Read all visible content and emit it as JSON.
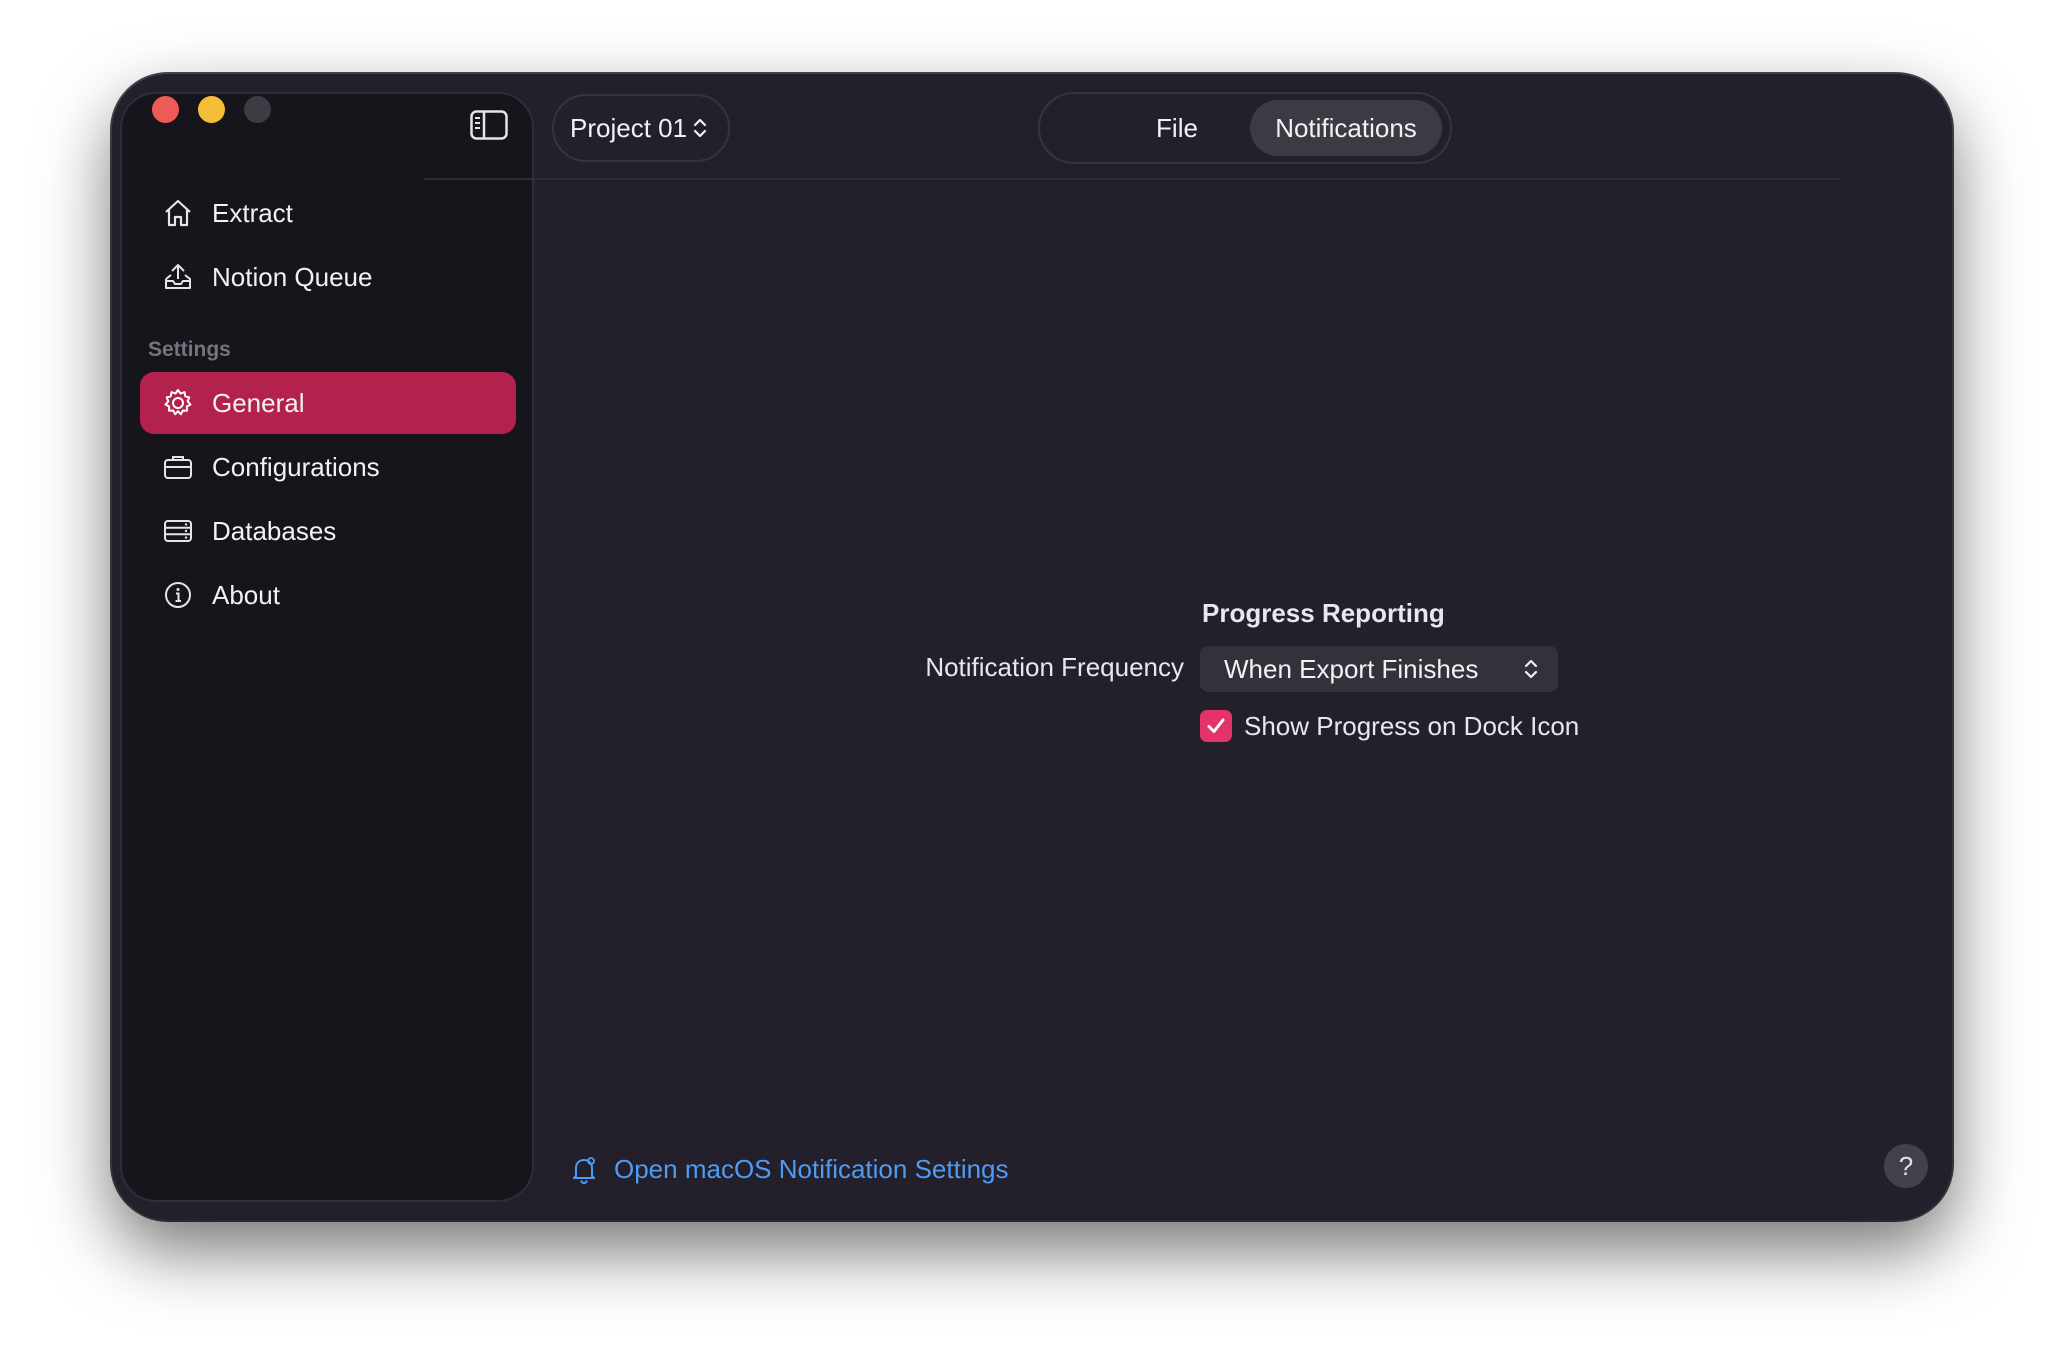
{
  "window": {
    "traffic_lights": [
      "close",
      "minimize",
      "zoom"
    ]
  },
  "sidebar": {
    "toggle_icon": "sidebar-toggle-icon",
    "items": [
      {
        "label": "Extract",
        "icon": "house-icon"
      },
      {
        "label": "Notion Queue",
        "icon": "tray-upload-icon"
      }
    ],
    "section_label": "Settings",
    "settings_items": [
      {
        "label": "General",
        "icon": "gear-icon",
        "selected": true
      },
      {
        "label": "Configurations",
        "icon": "briefcase-icon"
      },
      {
        "label": "Databases",
        "icon": "server-icon"
      },
      {
        "label": "About",
        "icon": "info-icon"
      }
    ]
  },
  "toolbar": {
    "project_picker": "Project 01",
    "tabs": [
      {
        "label": "File",
        "selected": false
      },
      {
        "label": "Notifications",
        "selected": true
      }
    ]
  },
  "form": {
    "section_title": "Progress Reporting",
    "frequency_label": "Notification Frequency",
    "frequency_value": "When Export Finishes",
    "dock_checkbox_label": "Show Progress on Dock Icon",
    "dock_checkbox_checked": true
  },
  "footer": {
    "open_settings_label": "Open macOS Notification Settings",
    "help_label": "?"
  },
  "colors": {
    "accent": "#b3214d",
    "checkbox": "#e3336a",
    "link": "#4e9bf1",
    "window_bg": "#23202b",
    "sidebar_bg": "#17151c"
  }
}
